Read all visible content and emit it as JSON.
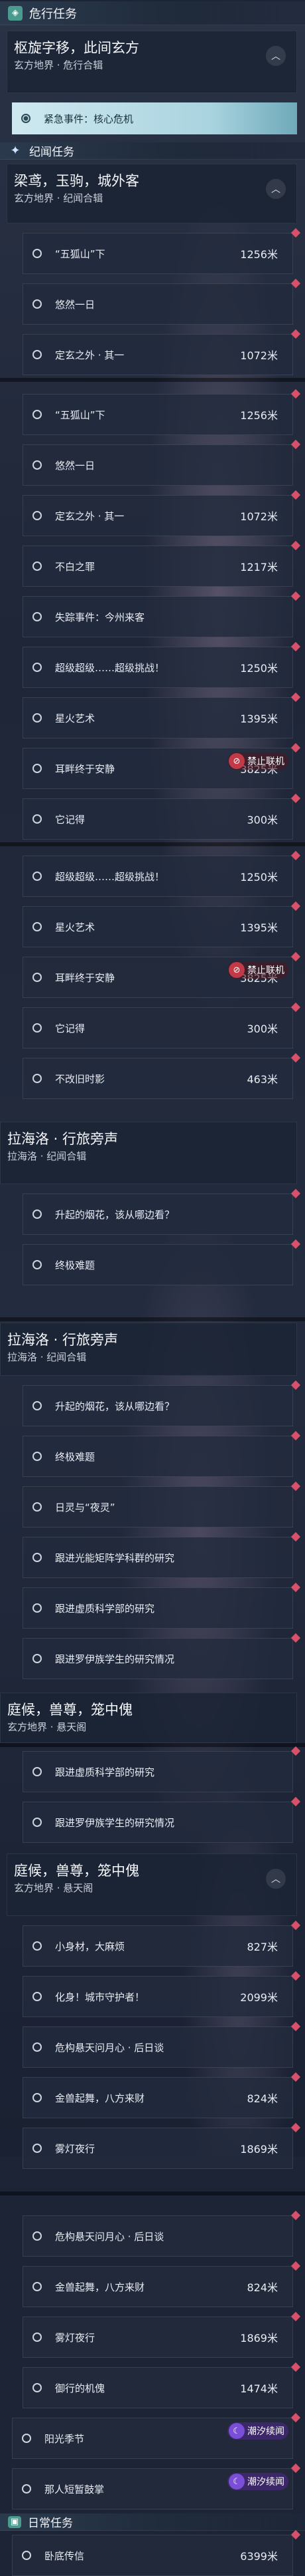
{
  "danger": {
    "header": "危行任务",
    "block": {
      "title": "枢旋字移，此间玄方",
      "sub": "玄方地界 · 危行合辑"
    },
    "selected": "紧急事件：核心危机"
  },
  "ji": {
    "header": "纪闻任务",
    "block": {
      "title": "梁鸢，玉驹，城外客",
      "sub": "玄方地界 · 纪闻合辑"
    }
  },
  "seg1": [
    {
      "label": "“五狐山”下",
      "dist": "1256米"
    },
    {
      "label": "悠然一日",
      "dist": ""
    },
    {
      "label": "定玄之外 · 其一",
      "dist": "1072米"
    }
  ],
  "seg2": [
    {
      "label": "“五狐山”下",
      "dist": "1256米"
    },
    {
      "label": "悠然一日",
      "dist": ""
    },
    {
      "label": "定玄之外 · 其一",
      "dist": "1072米"
    },
    {
      "label": "不白之罪",
      "dist": "1217米"
    },
    {
      "label": "失踪事件：今州来客",
      "dist": ""
    },
    {
      "label": "超级超级……超级挑战！",
      "dist": "1250米"
    },
    {
      "label": "星火艺术",
      "dist": "1395米"
    },
    {
      "label": "耳畔终于安静",
      "dist": "3825米"
    },
    {
      "label": "它记得",
      "dist": "300米"
    }
  ],
  "seg3": [
    {
      "label": "超级超级……超级挑战！",
      "dist": "1250米"
    },
    {
      "label": "星火艺术",
      "dist": "1395米"
    },
    {
      "label": "耳畔终于安静",
      "dist": "3825米"
    },
    {
      "label": "它记得",
      "dist": "300米"
    },
    {
      "label": "不改旧时影",
      "dist": "463米"
    }
  ],
  "badges": {
    "ban": "禁止联机",
    "tide": "潮汐续闻"
  },
  "la": {
    "title": "拉海洛 · 行旅旁声",
    "sub": "拉海洛 · 纪闻合辑"
  },
  "seg4": [
    {
      "label": "升起的烟花，该从哪边看？",
      "dist": ""
    },
    {
      "label": "终极难题",
      "dist": ""
    }
  ],
  "seg5": [
    {
      "label": "升起的烟花，该从哪边看？",
      "dist": ""
    },
    {
      "label": "终极难题",
      "dist": ""
    },
    {
      "label": "日灵与“夜灵”",
      "dist": ""
    },
    {
      "label": "跟进光能矩阵学科群的研究",
      "dist": ""
    },
    {
      "label": "跟进虚质科学部的研究",
      "dist": ""
    },
    {
      "label": "跟进罗伊族学生的研究情况",
      "dist": ""
    }
  ],
  "ting": {
    "title": "庭候，兽尊，笼中傀",
    "sub": "玄方地界 · 悬天阁"
  },
  "seg6": [
    {
      "label": "跟进虚质科学部的研究",
      "dist": ""
    },
    {
      "label": "跟进罗伊族学生的研究情况",
      "dist": ""
    }
  ],
  "seg7": [
    {
      "label": "小身材，大麻烦",
      "dist": "827米"
    },
    {
      "label": "化身！城市守护者！",
      "dist": "2099米"
    },
    {
      "label": "危构悬天问月心 · 后日谈",
      "dist": ""
    },
    {
      "label": "金兽起舞，八方来财",
      "dist": "824米"
    },
    {
      "label": "雾灯夜行",
      "dist": "1869米"
    }
  ],
  "seg8": [
    {
      "label": "危构悬天问月心 · 后日谈",
      "dist": ""
    },
    {
      "label": "金兽起舞，八方来财",
      "dist": "824米"
    },
    {
      "label": "雾灯夜行",
      "dist": "1869米"
    },
    {
      "label": "御行的机傀",
      "dist": "1474米"
    }
  ],
  "seg9": [
    {
      "label": "阳光季节",
      "dist": ""
    },
    {
      "label": "那人短暂鼓掌",
      "dist": ""
    }
  ],
  "daily": {
    "header": "日常任务",
    "item": {
      "label": "卧底传信",
      "dist": "6399米"
    }
  }
}
